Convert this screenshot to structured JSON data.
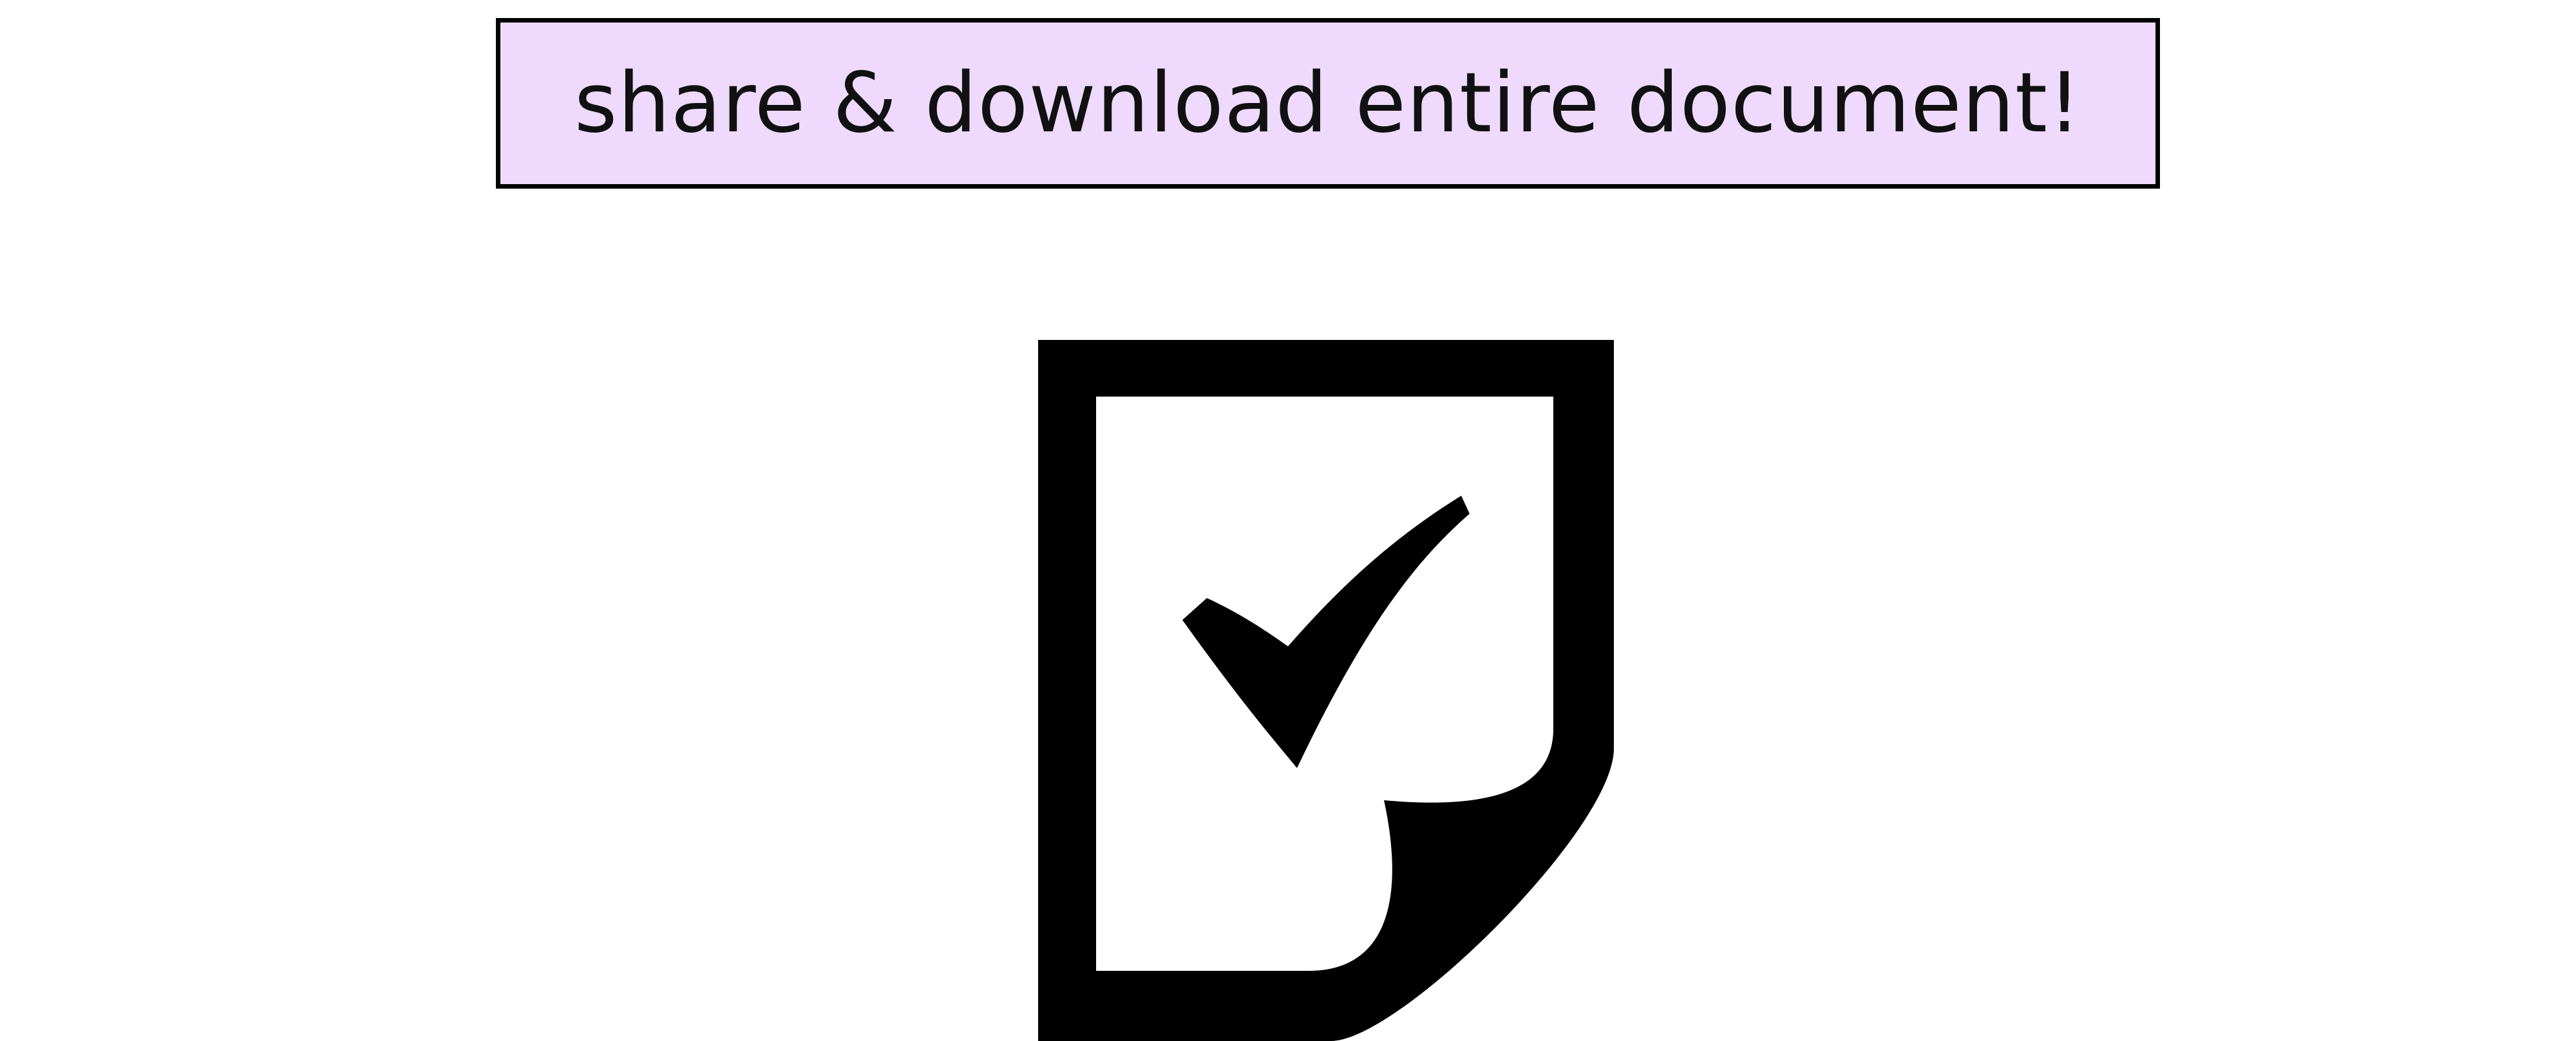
{
  "banner": {
    "label": "share & download entire document!",
    "background_color": "#efdafd",
    "border_color": "#000000"
  },
  "icon": {
    "name": "document-check-icon",
    "color": "#000000"
  }
}
